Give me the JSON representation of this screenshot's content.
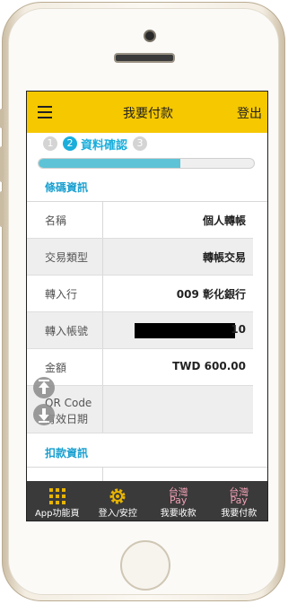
{
  "header": {
    "title": "我要付款",
    "logout": "登出"
  },
  "steps": [
    {
      "num": "1",
      "label": ""
    },
    {
      "num": "2",
      "label": "資料確認"
    },
    {
      "num": "3",
      "label": ""
    }
  ],
  "progress": 0.66,
  "barcode_section": {
    "title": "條碼資訊"
  },
  "fields": [
    {
      "key": "名稱",
      "value": "個人轉帳"
    },
    {
      "key": "交易類型",
      "value": "轉帳交易"
    },
    {
      "key": "轉入行",
      "value": "009 彰化銀行"
    },
    {
      "key": "轉入帳號",
      "value": "10"
    },
    {
      "key": "金額",
      "value": "TWD 600.00"
    },
    {
      "key_line1": "QR Code",
      "key_line2": "有效日期",
      "value": ""
    }
  ],
  "debit_section": {
    "title": "扣款資訊"
  },
  "tabs": [
    {
      "label": "App功能頁"
    },
    {
      "label": "登入/安控"
    },
    {
      "label": "我要收款",
      "brand1": "台灣",
      "brand2": "Pay"
    },
    {
      "label": "我要付款",
      "brand1": "台灣",
      "brand2": "Pay"
    }
  ],
  "colors": {
    "accent": "#f6c800",
    "step_active": "#1aaedb",
    "tabbar": "#3a3a3a",
    "pay": "#f0a0b5"
  }
}
